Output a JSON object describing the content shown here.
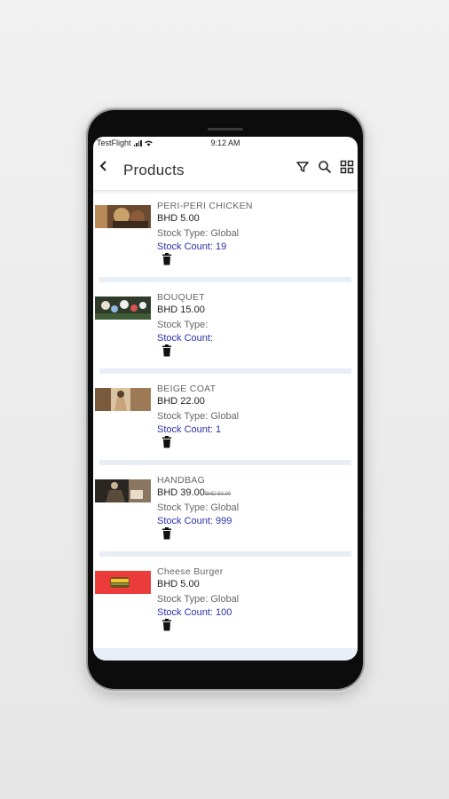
{
  "status_bar": {
    "carrier": "TestFlight",
    "time": "9:12 AM"
  },
  "header": {
    "title": "Products"
  },
  "icons": {
    "back": "back-arrow-icon",
    "filter": "filter-icon",
    "search": "search-icon",
    "grid": "grid-view-icon",
    "delete": "trash-icon"
  },
  "colors": {
    "stock_count": "#2c2fa6",
    "separator": "#e9edf6"
  },
  "products": [
    {
      "name": "PERI-PERI CHICKEN",
      "price": "BHD 5.00",
      "old_price": "",
      "stock_type": "Stock Type: Global",
      "stock_count": "Stock Count: 19"
    },
    {
      "name": "BOUQUET",
      "price": "BHD 15.00",
      "old_price": "",
      "stock_type": "Stock Type:",
      "stock_count": "Stock Count:"
    },
    {
      "name": "BEIGE COAT",
      "price": "BHD 22.00",
      "old_price": "",
      "stock_type": "Stock Type: Global",
      "stock_count": "Stock Count: 1"
    },
    {
      "name": "HANDBAG",
      "price": "BHD 39.00",
      "old_price": "BHD 50.00",
      "stock_type": "Stock Type: Global",
      "stock_count": "Stock Count: 999"
    },
    {
      "name": "Cheese Burger",
      "price": "BHD 5.00",
      "old_price": "",
      "stock_type": "Stock Type: Global",
      "stock_count": "Stock Count: 100"
    }
  ]
}
